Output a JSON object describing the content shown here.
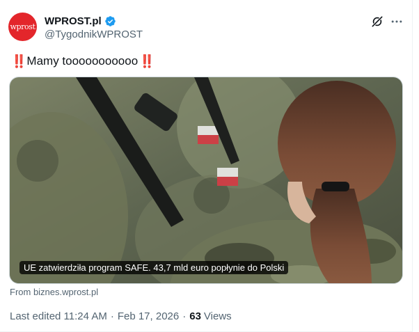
{
  "author": {
    "display_name": "WPROST.pl",
    "handle": "@TygodnikWPROST",
    "avatar_text": "wprost",
    "verified": true
  },
  "tweet": {
    "text": "Mamy tooooooooooo",
    "emoji": "‼️"
  },
  "card": {
    "title": "UE zatwierdziła program SAFE. 43,7 mld euro popłynie do Polski",
    "source": "From biznes.wprost.pl"
  },
  "meta": {
    "edited_time": "Last edited 11:24 AM",
    "date": "Feb 17, 2026",
    "views_count": "63",
    "views_label": "Views"
  },
  "icons": {
    "verified": "verified-badge-icon",
    "grok": "grok-icon",
    "more": "more-horizontal-icon"
  },
  "colors": {
    "avatar_bg": "#e3262b",
    "verified_blue": "#1d9bf0",
    "emoji_red": "#dd2e44",
    "secondary_text": "#536471"
  }
}
